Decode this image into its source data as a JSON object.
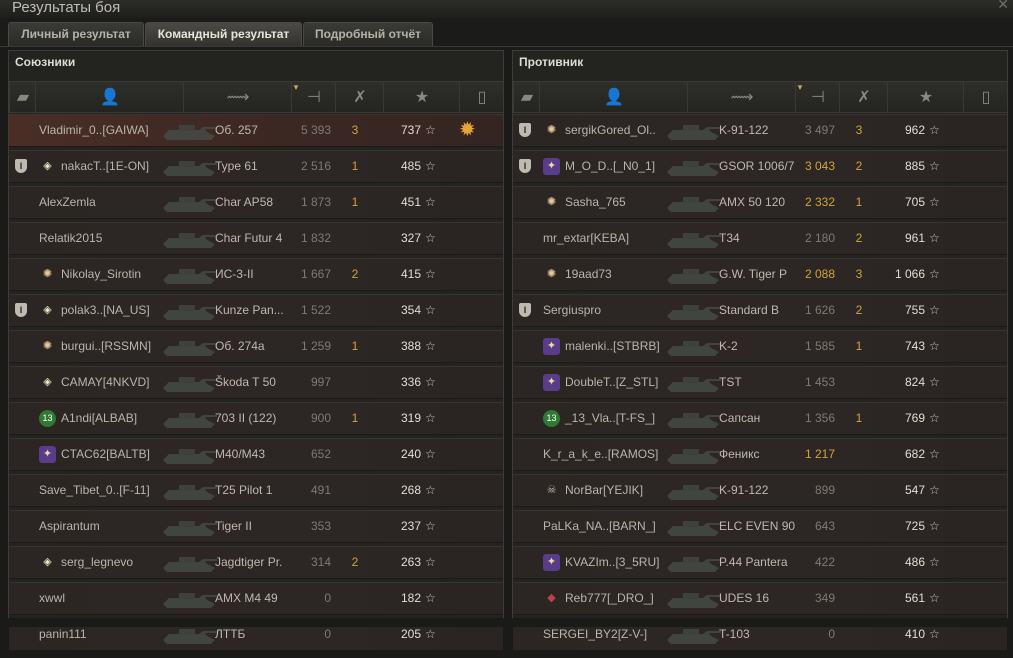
{
  "window": {
    "title": "Результаты боя"
  },
  "tabs": [
    {
      "label": "Личный результат",
      "active": false
    },
    {
      "label": "Командный результат",
      "active": true
    },
    {
      "label": "Подробный отчёт",
      "active": false
    }
  ],
  "allies": {
    "title": "Союзники",
    "rows": [
      {
        "player": "Vladimir_0..[GAIWA]",
        "badge": "",
        "platoon": false,
        "tank": "Об. 257",
        "damage": "5 393",
        "kills": "3",
        "xp": "737",
        "medal": true,
        "me": true
      },
      {
        "player": "nakacT..[1E-ON]",
        "badge": "diamond",
        "platoon": true,
        "tank": "Type 61",
        "damage": "2 516",
        "kills": "1",
        "xp": "485"
      },
      {
        "player": "AlexZemla",
        "badge": "",
        "platoon": false,
        "tank": "Char AP58",
        "damage": "1 873",
        "kills": "1",
        "xp": "451"
      },
      {
        "player": "Relatik2015",
        "badge": "",
        "platoon": false,
        "tank": "Char Futur 4",
        "damage": "1 832",
        "kills": "",
        "xp": "327"
      },
      {
        "player": "Nikolay_Sirotin",
        "badge": "star",
        "platoon": false,
        "tank": "ИС-3-II",
        "damage": "1 667",
        "kills": "2",
        "xp": "415"
      },
      {
        "player": "polak3..[NA_US]",
        "badge": "diamond",
        "platoon": true,
        "tank": "Kunze Pan...",
        "damage": "1 522",
        "kills": "",
        "xp": "354"
      },
      {
        "player": "burgui..[RSSMN]",
        "badge": "star",
        "platoon": false,
        "tank": "Об. 274а",
        "damage": "1 259",
        "kills": "1",
        "xp": "388"
      },
      {
        "player": "CAMAY[4NKVD]",
        "badge": "diamond",
        "platoon": false,
        "tank": "Škoda T 50",
        "damage": "997",
        "kills": "",
        "xp": "336"
      },
      {
        "player": "A1ndi[ALBAB]",
        "badge": "green",
        "badge_text": "13",
        "platoon": false,
        "tank": "703 II (122)",
        "damage": "900",
        "kills": "1",
        "xp": "319"
      },
      {
        "player": "CTAC62[BALTB]",
        "badge": "purple",
        "platoon": false,
        "tank": "M40/M43",
        "damage": "652",
        "kills": "",
        "xp": "240"
      },
      {
        "player": "Save_Tibet_0..[F-11]",
        "badge": "",
        "platoon": false,
        "tank": "T25 Pilot 1",
        "damage": "491",
        "kills": "",
        "xp": "268"
      },
      {
        "player": "Aspirantum",
        "badge": "",
        "platoon": false,
        "tank": "Tiger II",
        "damage": "353",
        "kills": "",
        "xp": "237"
      },
      {
        "player": "serg_legnevo",
        "badge": "diamond",
        "platoon": false,
        "tank": "Jagdtiger Pr.",
        "damage": "314",
        "kills": "2",
        "xp": "263"
      },
      {
        "player": "xwwl",
        "badge": "",
        "platoon": false,
        "tank": "AMX M4 49",
        "damage": "0",
        "kills": "",
        "xp": "182"
      },
      {
        "player": "panin111",
        "badge": "",
        "platoon": false,
        "tank": "ЛТТБ",
        "damage": "0",
        "kills": "",
        "xp": "205"
      }
    ]
  },
  "enemies": {
    "title": "Противник",
    "rows": [
      {
        "player": "sergikGored_Ol..",
        "badge": "star",
        "platoon": true,
        "tank": "K-91-122",
        "damage": "3 497",
        "kills": "3",
        "xp": "962"
      },
      {
        "player": "M_O_D..[_N0_1]",
        "badge": "purple",
        "platoon": true,
        "tank": "GSOR 1006/7",
        "damage": "3 043",
        "kills": "2",
        "xp": "885",
        "bright": true
      },
      {
        "player": "Sasha_765",
        "badge": "star",
        "platoon": false,
        "tank": "AMX 50 120",
        "damage": "2 332",
        "kills": "1",
        "xp": "705",
        "bright": true
      },
      {
        "player": "mr_extar[KEBA]",
        "badge": "",
        "platoon": false,
        "tank": "T34",
        "damage": "2 180",
        "kills": "2",
        "xp": "961"
      },
      {
        "player": "19aad73",
        "badge": "star",
        "platoon": false,
        "tank": "G.W. Tiger P",
        "damage": "2 088",
        "kills": "3",
        "xp": "1 066",
        "bright": true
      },
      {
        "player": "Sergiuspro",
        "badge": "",
        "platoon": true,
        "tank": "Standard B",
        "damage": "1 626",
        "kills": "2",
        "xp": "755"
      },
      {
        "player": "malenki..[STBRB]",
        "badge": "purple",
        "platoon": false,
        "tank": "K-2",
        "damage": "1 585",
        "kills": "1",
        "xp": "743"
      },
      {
        "player": "DoubleT..[Z_STL]",
        "badge": "purple",
        "platoon": false,
        "tank": "TST",
        "damage": "1 453",
        "kills": "",
        "xp": "824"
      },
      {
        "player": "_13_Vla..[T-FS_]",
        "badge": "green",
        "badge_text": "13",
        "platoon": false,
        "tank": "Сапсан",
        "damage": "1 356",
        "kills": "1",
        "xp": "769"
      },
      {
        "player": "K_r_a_k_e..[RAMOS]",
        "badge": "",
        "platoon": false,
        "tank": "Феникс",
        "damage": "1 217",
        "kills": "",
        "xp": "682",
        "bright": true
      },
      {
        "player": "NorBar[YEJIK]",
        "badge": "skull",
        "platoon": false,
        "tank": "K-91-122",
        "damage": "899",
        "kills": "",
        "xp": "547"
      },
      {
        "player": "PaLKa_NA..[BARN_]",
        "badge": "",
        "platoon": false,
        "tank": "ELC EVEN 90",
        "damage": "643",
        "kills": "",
        "xp": "725"
      },
      {
        "player": "KVAZIm..[3_5RU]",
        "badge": "purple",
        "platoon": false,
        "tank": "P.44 Pantera",
        "damage": "422",
        "kills": "",
        "xp": "486"
      },
      {
        "player": "Reb777[_DRO_]",
        "badge": "lips",
        "platoon": false,
        "tank": "UDES 16",
        "damage": "349",
        "kills": "",
        "xp": "561"
      },
      {
        "player": "SERGEI_BY2[Z-V-]",
        "badge": "",
        "platoon": false,
        "tank": "T-103",
        "damage": "0",
        "kills": "",
        "xp": "410"
      }
    ]
  },
  "icons": {
    "platoon": "platoon-icon",
    "player": "player-icon",
    "tank": "tank-icon",
    "damage": "damage-icon",
    "kills": "kills-icon",
    "xp": "star-icon",
    "medal": "medal-icon"
  },
  "colors": {
    "highlight_damage": "#d4a43a",
    "kills": "#d6a23a",
    "me_row": "#4a2e26"
  }
}
